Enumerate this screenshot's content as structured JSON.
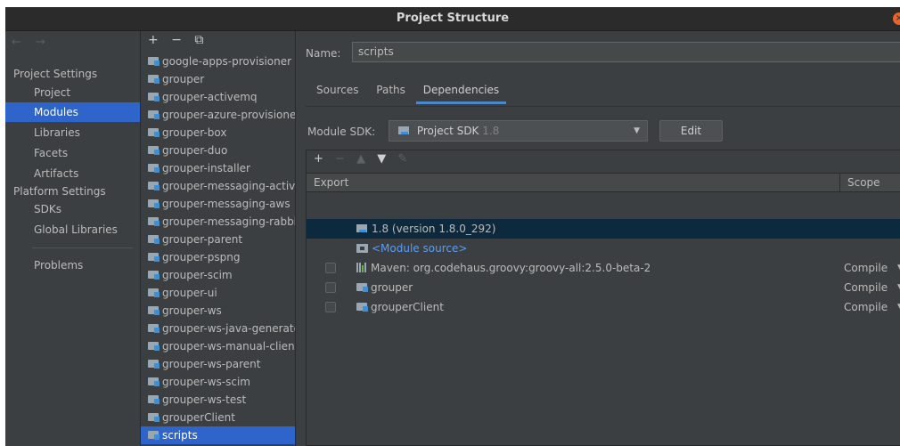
{
  "window": {
    "title": "Project Structure",
    "close_glyph": "×"
  },
  "nav": {
    "arrows": "← →",
    "project_settings_header": "Project Settings",
    "project_items": [
      "Project",
      "Modules",
      "Libraries",
      "Facets",
      "Artifacts"
    ],
    "platform_settings_header": "Platform Settings",
    "platform_items": [
      "SDKs",
      "Global Libraries"
    ],
    "problems": "Problems",
    "selected": "Modules"
  },
  "modules": {
    "toolbar": {
      "add": "+",
      "remove": "−",
      "copy": "⧉"
    },
    "items": [
      "google-apps-provisioner",
      "grouper",
      "grouper-activemq",
      "grouper-azure-provisioner",
      "grouper-box",
      "grouper-duo",
      "grouper-installer",
      "grouper-messaging-activemq",
      "grouper-messaging-aws",
      "grouper-messaging-rabbitmq",
      "grouper-parent",
      "grouper-pspng",
      "grouper-scim",
      "grouper-ui",
      "grouper-ws",
      "grouper-ws-java-generated",
      "grouper-ws-manual-client",
      "grouper-ws-parent",
      "grouper-ws-scim",
      "grouper-ws-test",
      "grouperClient",
      "scripts"
    ],
    "selected": "scripts"
  },
  "main": {
    "name_label": "Name:",
    "name_value": "scripts",
    "tabs": [
      "Sources",
      "Paths",
      "Dependencies"
    ],
    "active_tab": "Dependencies",
    "sdk_label": "Module SDK:",
    "sdk_value": "Project SDK",
    "sdk_version": "1.8",
    "edit_label": "Edit",
    "dep_toolbar": {
      "add": "+",
      "remove": "−",
      "up": "▲",
      "down": "▼",
      "edit": "✎"
    },
    "columns": {
      "export": "Export",
      "scope": "Scope"
    },
    "dependencies": [
      {
        "text": "1.8 (version 1.8.0_292)",
        "icon": "jdk-icon",
        "scope": ""
      },
      {
        "text": "<Module source>",
        "icon": "source-folder-icon",
        "scope": ""
      },
      {
        "text": "Maven: org.codehaus.groovy:groovy-all:2.5.0-beta-2",
        "icon": "library-icon",
        "scope": "Compile"
      },
      {
        "text": "grouper",
        "icon": "module-icon",
        "scope": "Compile"
      },
      {
        "text": "grouperClient",
        "icon": "module-icon",
        "scope": "Compile"
      }
    ]
  },
  "colors": {
    "background": "#3c3f41",
    "selection": "#2f65ca",
    "row_selection": "#0d293e",
    "link": "#589df6",
    "close": "#e8642b"
  }
}
